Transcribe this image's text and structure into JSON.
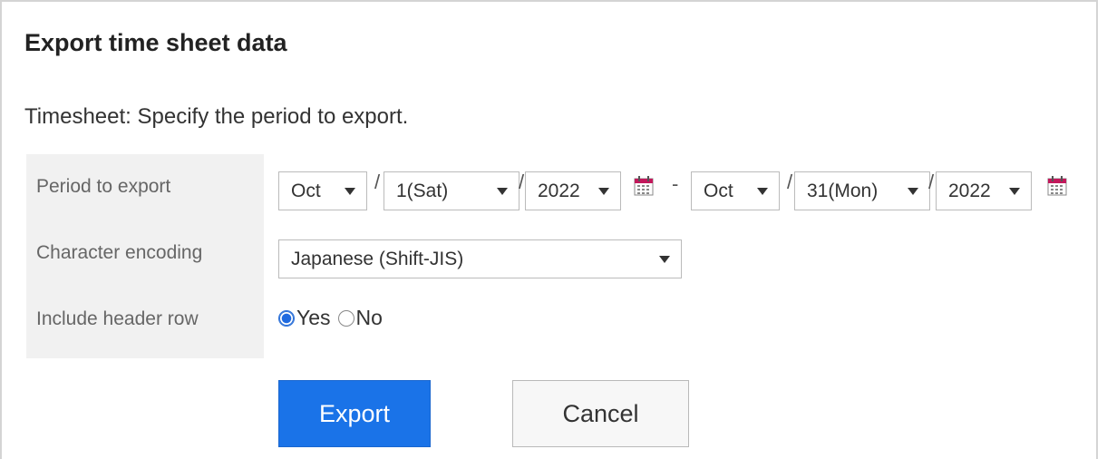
{
  "dialog": {
    "title": "Export time sheet data",
    "description": "Timesheet: Specify the period to export."
  },
  "form": {
    "period": {
      "label": "Period to export",
      "from_month": "Oct",
      "from_day": "1(Sat)",
      "from_year": "2022",
      "to_month": "Oct",
      "to_day": "31(Mon)",
      "to_year": "2022",
      "separator": "/",
      "range_dash": "-",
      "calendar_icon": "calendar-icon"
    },
    "encoding": {
      "label": "Character encoding",
      "value": "Japanese (Shift-JIS)"
    },
    "header_row": {
      "label": "Include header row",
      "options": [
        "Yes",
        "No"
      ],
      "selected": "Yes"
    }
  },
  "actions": {
    "export_label": "Export",
    "cancel_label": "Cancel"
  },
  "colors": {
    "primary": "#1a73e8",
    "label_bg": "#f1f1f1",
    "calendar_accent": "#c2185b"
  }
}
